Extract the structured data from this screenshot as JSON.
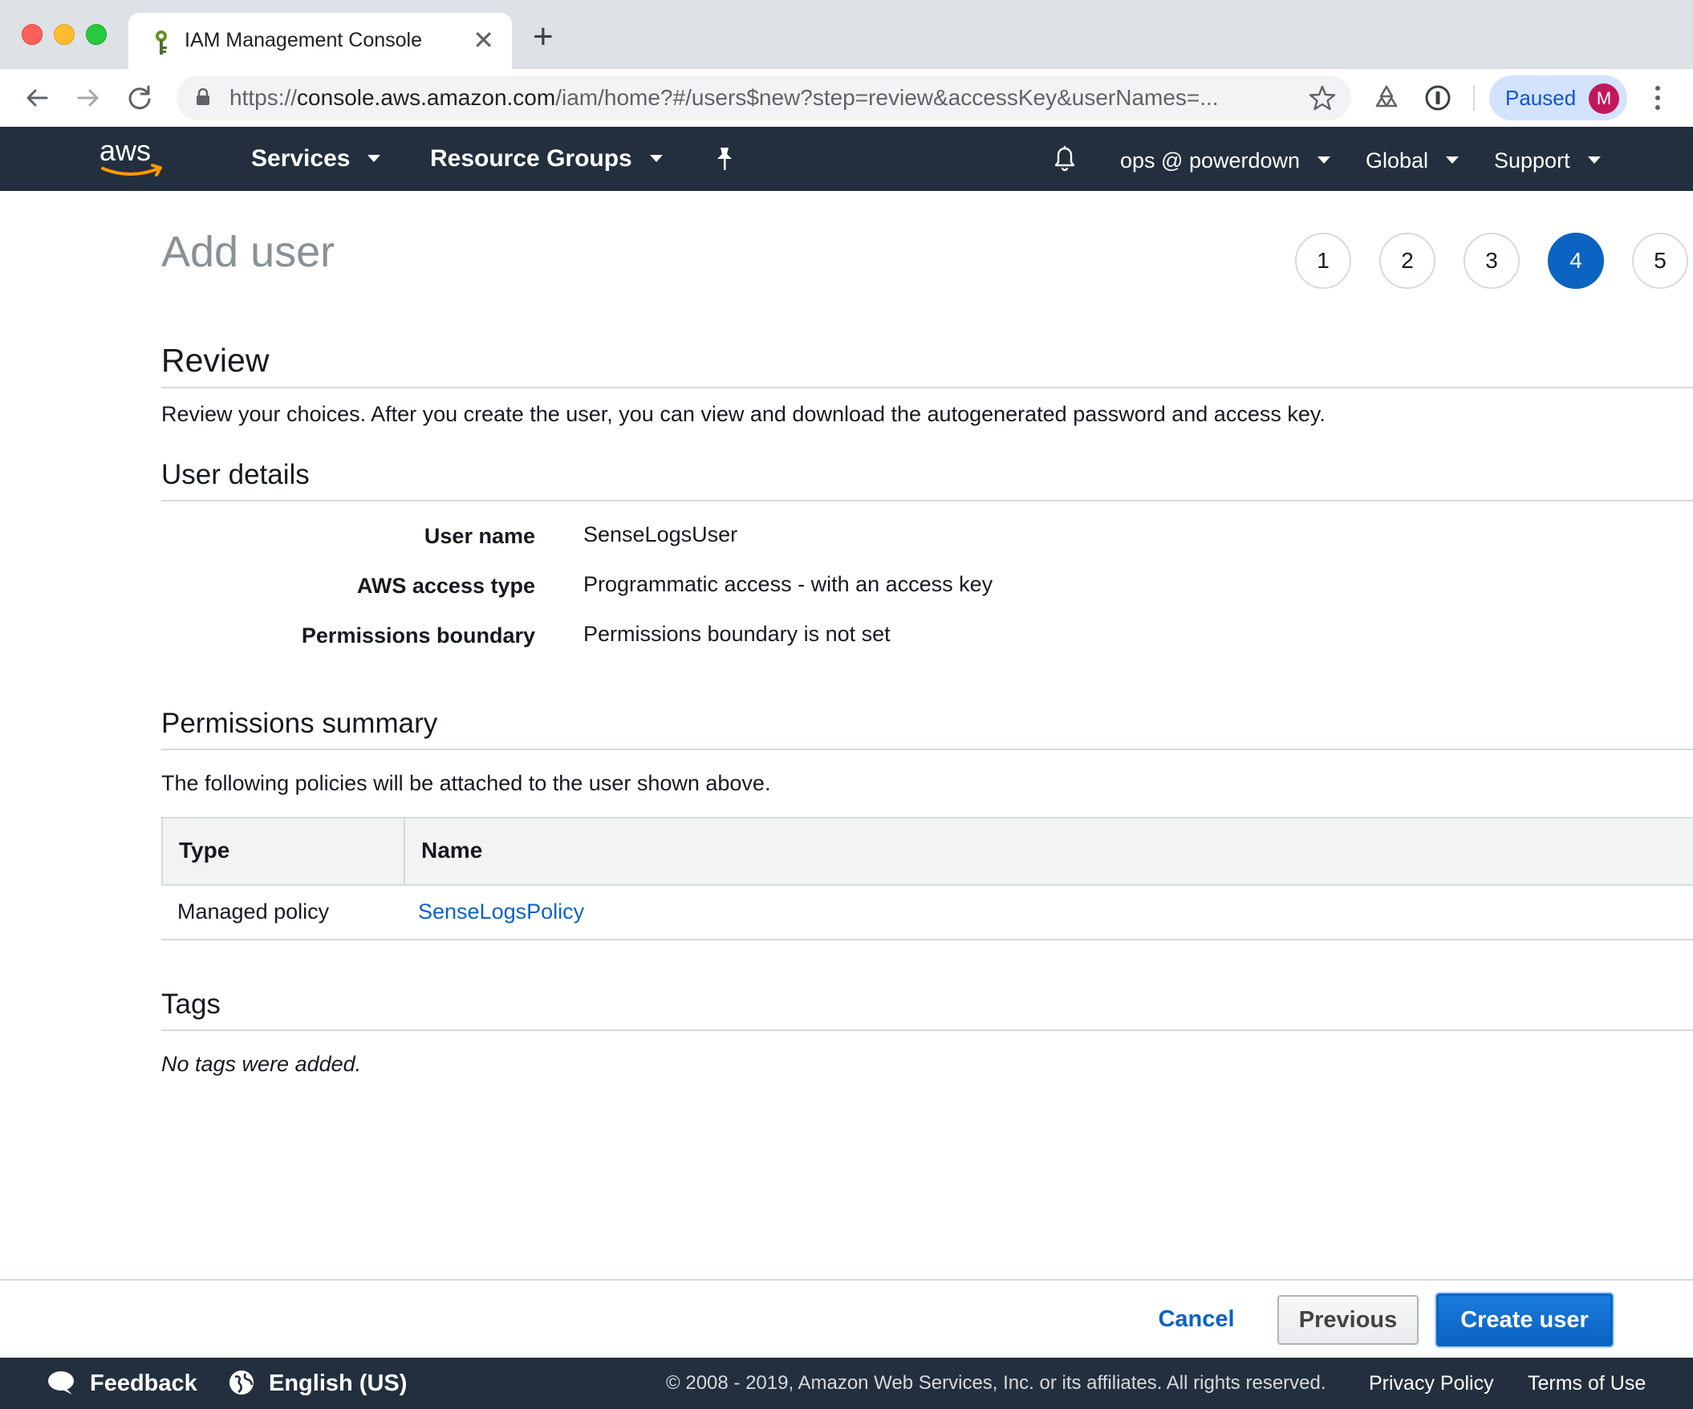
{
  "browser": {
    "tab_title": "IAM Management Console",
    "url_scheme": "https://",
    "url_host": "console.aws.amazon.com",
    "url_path": "/iam/home?#/users$new?step=review&accessKey&userNames=...",
    "profile_status": "Paused",
    "profile_initial": "M"
  },
  "aws_nav": {
    "logo_text": "aws",
    "services": "Services",
    "resource_groups": "Resource Groups",
    "account": "ops @ powerdown",
    "region": "Global",
    "support": "Support"
  },
  "page": {
    "title": "Add user",
    "steps": [
      "1",
      "2",
      "3",
      "4",
      "5"
    ],
    "active_step": 4
  },
  "review": {
    "heading": "Review",
    "description": "Review your choices. After you create the user, you can view and download the autogenerated password and access key."
  },
  "user_details": {
    "heading": "User details",
    "rows": [
      {
        "label": "User name",
        "value": "SenseLogsUser"
      },
      {
        "label": "AWS access type",
        "value": "Programmatic access - with an access key"
      },
      {
        "label": "Permissions boundary",
        "value": "Permissions boundary is not set"
      }
    ]
  },
  "permissions_summary": {
    "heading": "Permissions summary",
    "description": "The following policies will be attached to the user shown above.",
    "columns": [
      "Type",
      "Name"
    ],
    "rows": [
      {
        "type": "Managed policy",
        "name": "SenseLogsPolicy"
      }
    ]
  },
  "tags": {
    "heading": "Tags",
    "empty_text": "No tags were added."
  },
  "actions": {
    "cancel": "Cancel",
    "previous": "Previous",
    "create": "Create user"
  },
  "footer": {
    "feedback": "Feedback",
    "language": "English (US)",
    "copyright": "© 2008 - 2019, Amazon Web Services, Inc. or its affiliates. All rights reserved.",
    "privacy": "Privacy Policy",
    "terms": "Terms of Use"
  },
  "colors": {
    "aws_nav_bg": "#232f3e",
    "link_blue": "#0b63c2",
    "aws_orange": "#ff9900"
  }
}
